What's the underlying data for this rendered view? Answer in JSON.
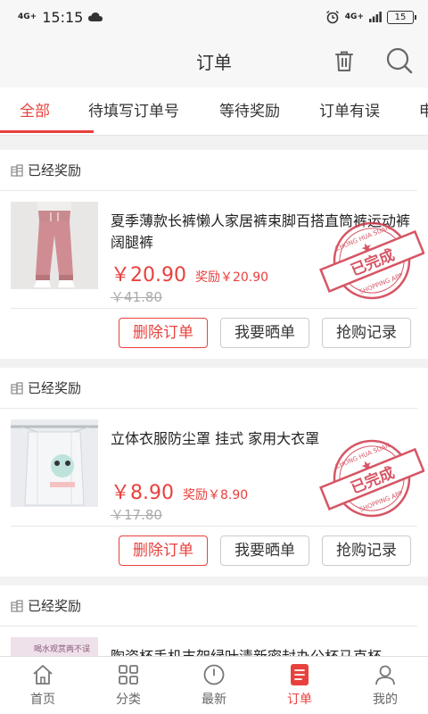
{
  "statusbar": {
    "time": "15:15",
    "signal_left": "4G+",
    "signal_right": "4G+",
    "battery": "15"
  },
  "header": {
    "title": "订单",
    "trash_icon": "trash-icon",
    "search_icon": "search-icon"
  },
  "tabs": [
    {
      "label": "全部",
      "active": true
    },
    {
      "label": "待填写订单号"
    },
    {
      "label": "等待奖励"
    },
    {
      "label": "订单有误"
    },
    {
      "label": "申"
    }
  ],
  "orders": [
    {
      "status": "已经奖励",
      "name": "夏季薄款长裤懒人家居裤束脚百搭直筒裤运动裤阔腿裤",
      "price": "￥20.90",
      "reward": "奖励￥20.90",
      "original_price": "￥41.80",
      "stamp": {
        "main": "已完成",
        "top": "ZHONG HUA SUAN",
        "bottom": "SHOPPING APP"
      }
    },
    {
      "status": "已经奖励",
      "name": "立体衣服防尘罩 挂式 家用大衣罩",
      "price": "￥8.90",
      "reward": "奖励￥8.90",
      "original_price": "￥17.80",
      "stamp": {
        "main": "已完成",
        "top": "ZHONG HUA SUAN",
        "bottom": "SHOPPING APP"
      }
    },
    {
      "status": "已经奖励",
      "name": "陶瓷杯手机支架绿叶清新密封办公杯马克杯",
      "thumb_text": "喝水观赏两不误"
    }
  ],
  "buttons": {
    "delete": "删除订单",
    "share": "我要晒单",
    "records": "抢购记录"
  },
  "bottom_nav": [
    {
      "label": "首页",
      "icon": "home-icon"
    },
    {
      "label": "分类",
      "icon": "category-icon"
    },
    {
      "label": "最新",
      "icon": "clock-icon"
    },
    {
      "label": "订单",
      "icon": "order-icon",
      "active": true
    },
    {
      "label": "我的",
      "icon": "user-icon"
    }
  ],
  "colors": {
    "accent": "#e8413d"
  }
}
